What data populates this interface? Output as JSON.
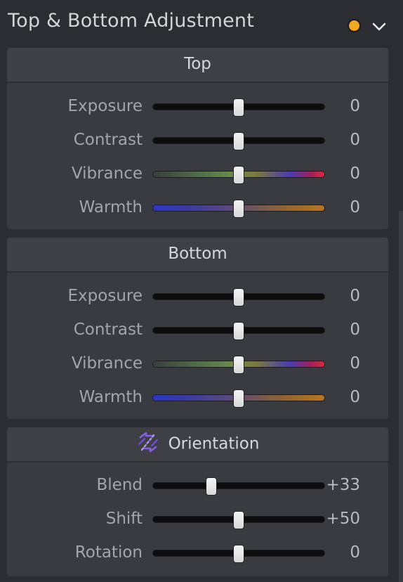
{
  "panel": {
    "title": "Top & Bottom Adjustment",
    "status_dot_color": "#f5a822",
    "collapse_icon": "chevron-down-icon"
  },
  "sections": {
    "top": {
      "title": "Top",
      "rows": [
        {
          "label": "Exposure",
          "value": "0",
          "track": "plain",
          "level": 0.5
        },
        {
          "label": "Contrast",
          "value": "0",
          "track": "plain",
          "level": 0.5
        },
        {
          "label": "Vibrance",
          "value": "0",
          "track": "vibrance",
          "level": 0.5
        },
        {
          "label": "Warmth",
          "value": "0",
          "track": "warmth",
          "level": 0.5
        }
      ]
    },
    "bottom": {
      "title": "Bottom",
      "rows": [
        {
          "label": "Exposure",
          "value": "0",
          "track": "plain",
          "level": 0.5
        },
        {
          "label": "Contrast",
          "value": "0",
          "track": "plain",
          "level": 0.5
        },
        {
          "label": "Vibrance",
          "value": "0",
          "track": "vibrance",
          "level": 0.5
        },
        {
          "label": "Warmth",
          "value": "0",
          "track": "warmth",
          "level": 0.5
        }
      ]
    },
    "orientation": {
      "title": "Orientation",
      "icon": "orientation-icon",
      "icon_color": "#8a5cf0",
      "rows": [
        {
          "label": "Blend",
          "value": "+33",
          "track": "plain",
          "level": 0.34
        },
        {
          "label": "Shift",
          "value": "+50",
          "track": "plain",
          "level": 0.5
        },
        {
          "label": "Rotation",
          "value": "0",
          "track": "plain",
          "level": 0.5
        }
      ]
    }
  }
}
